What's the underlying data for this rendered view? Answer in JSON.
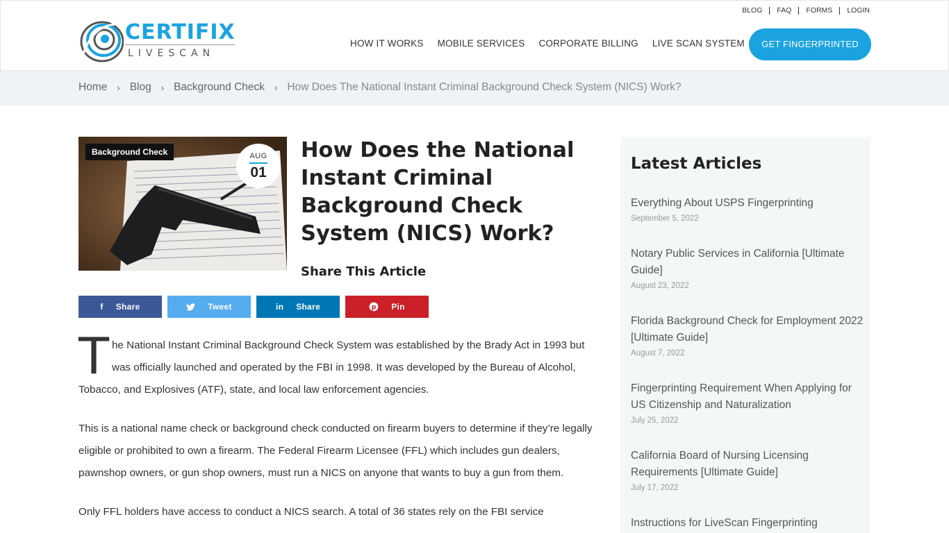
{
  "logo": {
    "top": "CERTIFIX",
    "bottom": "LIVESCAN"
  },
  "toplinks": [
    "BLOG",
    "FAQ",
    "FORMS",
    "LOGIN"
  ],
  "nav": [
    "HOW IT WORKS",
    "MOBILE SERVICES",
    "CORPORATE BILLING",
    "LIVE SCAN SYSTEM"
  ],
  "cta": "GET FINGERPRINTED",
  "breadcrumb": {
    "home": "Home",
    "blog": "Blog",
    "category": "Background Check",
    "current": "How Does The National Instant Criminal Background Check System (NICS) Work?"
  },
  "post": {
    "category_badge": "Background Check",
    "date_month": "AUG",
    "date_day": "01",
    "title": "How Does the National Instant Criminal Background Check System (NICS) Work?",
    "share_heading": "Share This Article",
    "share_buttons": {
      "facebook": "Share",
      "twitter": "Tweet",
      "linkedin": "Share",
      "pinterest": "Pin"
    },
    "dropcap": "T",
    "para1": "he National Instant Criminal Background Check System was established by the Brady Act in 1993 but was officially launched and operated by the FBI in 1998. It was developed by the Bureau of Alcohol, Tobacco, and Explosives (ATF), state, and local law enforcement agencies.",
    "para2": "This is a national name check or background check conducted on firearm buyers to determine if they’re legally eligible or prohibited to own a firearm. The Federal Firearm Licensee (FFL) which includes gun dealers, pawnshop owners, or gun shop owners, must run a NICS on anyone that wants to buy a gun from them.",
    "para3": "Only FFL holders have access to conduct a NICS search. A total of 36 states rely on the FBI service"
  },
  "sidebar": {
    "heading": "Latest Articles",
    "articles": [
      {
        "title": "Everything About USPS Fingerprinting",
        "date": "September 5, 2022"
      },
      {
        "title": "Notary Public Services in California [Ultimate Guide]",
        "date": "August 23, 2022"
      },
      {
        "title": "Florida Background Check for Employment 2022 [Ultimate Guide]",
        "date": "August 7, 2022"
      },
      {
        "title": "Fingerprinting Requirement When Applying for US Citizenship and Naturalization",
        "date": "July 25, 2022"
      },
      {
        "title": "California Board of Nursing Licensing Requirements [Ultimate Guide]",
        "date": "July 17, 2022"
      },
      {
        "title": "Instructions for LiveScan Fingerprinting",
        "date": ""
      }
    ]
  },
  "icons": {
    "logo": "logo-swirl-icon",
    "facebook": "facebook-icon",
    "twitter": "twitter-icon",
    "linkedin": "linkedin-icon",
    "pinterest": "pinterest-icon",
    "breadcrumb_sep": "chevron-right-icon"
  },
  "colors": {
    "accent": "#1aa3e0",
    "facebook": "#3b5998",
    "twitter": "#55acee",
    "linkedin": "#0077b5",
    "pinterest": "#cb2027"
  }
}
